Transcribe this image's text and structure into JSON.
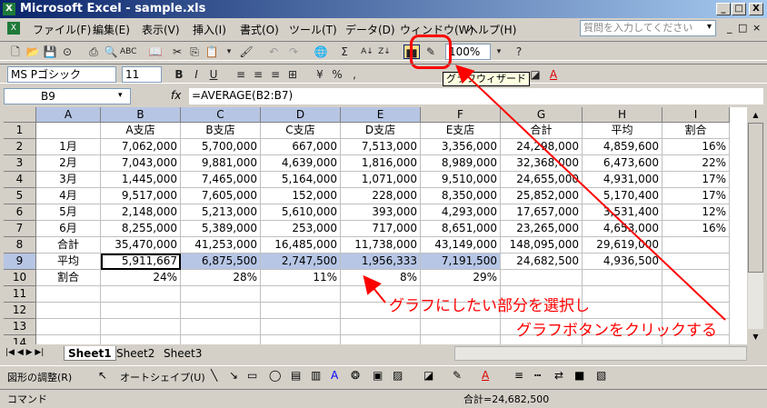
{
  "window": {
    "title": "Microsoft Excel - sample.xls",
    "min": "_",
    "restore": "□",
    "close": "X"
  },
  "menu": {
    "items": [
      "ファイル(F)",
      "編集(E)",
      "表示(V)",
      "挿入(I)",
      "書式(O)",
      "ツール(T)",
      "データ(D)",
      "ウィンドウ(W)",
      "ヘルプ(H)"
    ],
    "help_placeholder": "質問を入力してください"
  },
  "toolbar": {
    "zoom": "100%",
    "font_name": "MS Pゴシック",
    "font_size": "11",
    "tooltip": "グラフウィザード"
  },
  "formula_bar": {
    "cell_ref": "B9",
    "fx": "fx",
    "formula": "=AVERAGE(B2:B7)"
  },
  "grid": {
    "columns": [
      "A",
      "B",
      "C",
      "D",
      "E",
      "F",
      "G",
      "H",
      "I"
    ],
    "rows": [
      [
        "",
        "A支店",
        "B支店",
        "C支店",
        "D支店",
        "E支店",
        "合計",
        "平均",
        "割合"
      ],
      [
        "1月",
        "7,062,000",
        "5,700,000",
        "667,000",
        "7,513,000",
        "3,356,000",
        "24,298,000",
        "4,859,600",
        "16%"
      ],
      [
        "2月",
        "7,043,000",
        "9,881,000",
        "4,639,000",
        "1,816,000",
        "8,989,000",
        "32,368,000",
        "6,473,600",
        "22%"
      ],
      [
        "3月",
        "1,445,000",
        "7,465,000",
        "5,164,000",
        "1,071,000",
        "9,510,000",
        "24,655,000",
        "4,931,000",
        "17%"
      ],
      [
        "4月",
        "9,517,000",
        "7,605,000",
        "152,000",
        "228,000",
        "8,350,000",
        "25,852,000",
        "5,170,400",
        "17%"
      ],
      [
        "5月",
        "2,148,000",
        "5,213,000",
        "5,610,000",
        "393,000",
        "4,293,000",
        "17,657,000",
        "3,531,400",
        "12%"
      ],
      [
        "6月",
        "8,255,000",
        "5,389,000",
        "253,000",
        "717,000",
        "8,651,000",
        "23,265,000",
        "4,653,000",
        "16%"
      ],
      [
        "合計",
        "35,470,000",
        "41,253,000",
        "16,485,000",
        "11,738,000",
        "43,149,000",
        "148,095,000",
        "29,619,000",
        ""
      ],
      [
        "平均",
        "5,911,667",
        "6,875,500",
        "2,747,500",
        "1,956,333",
        "7,191,500",
        "24,682,500",
        "4,936,500",
        ""
      ],
      [
        "割合",
        "24%",
        "28%",
        "11%",
        "8%",
        "29%",
        "",
        "",
        ""
      ],
      [
        "",
        "",
        "",
        "",
        "",
        "",
        "",
        "",
        ""
      ],
      [
        "",
        "",
        "",
        "",
        "",
        "",
        "",
        "",
        ""
      ],
      [
        "",
        "",
        "",
        "",
        "",
        "",
        "",
        "",
        ""
      ],
      [
        "",
        "",
        "",
        "",
        "",
        "",
        "",
        "",
        ""
      ]
    ],
    "row_numbers": [
      "1",
      "2",
      "3",
      "4",
      "5",
      "6",
      "7",
      "8",
      "9",
      "10",
      "11",
      "12",
      "13",
      "14"
    ]
  },
  "sheets": [
    "Sheet1",
    "Sheet2",
    "Sheet3"
  ],
  "annotations": {
    "select_text": "グラフにしたい部分を選択し",
    "click_text": "グラフボタンをクリックする",
    "accent": "#ff0000"
  },
  "drawbar": {
    "adjust": "図形の調整(R)",
    "autoshape": "オートシェイプ(U)"
  },
  "status": {
    "mode": "コマンド",
    "sum": "合計=24,682,500"
  }
}
